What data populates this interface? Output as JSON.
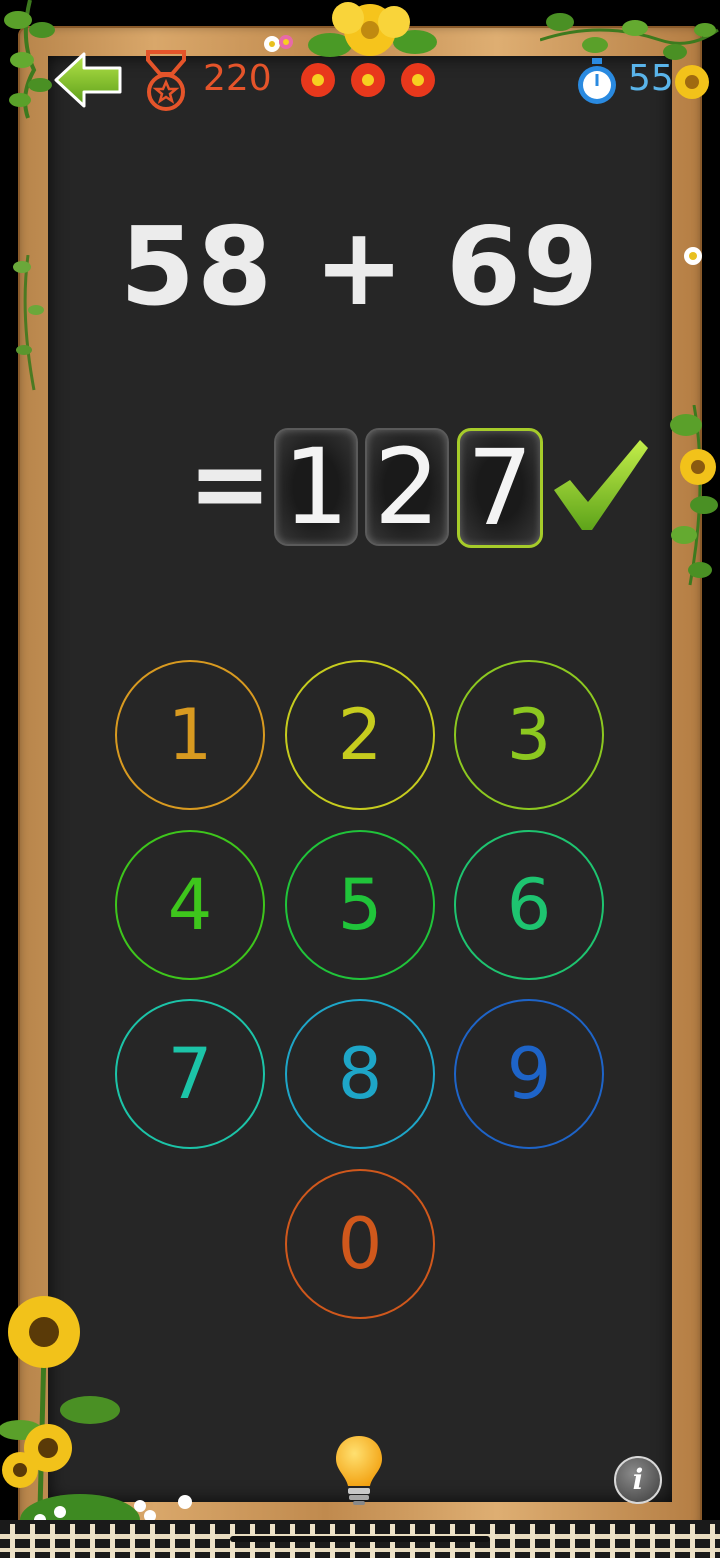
{
  "header": {
    "back_icon": "arrow-left-icon",
    "medal_icon": "medal-icon",
    "score": "220",
    "timer_icon": "stopwatch-icon",
    "timer": "55"
  },
  "problem": {
    "equation": "58 + 69",
    "equals": "=",
    "answer_digits": [
      "1",
      "2",
      "7"
    ],
    "active_index": 2,
    "status_icon": "checkmark-icon"
  },
  "keypad": [
    {
      "label": "1",
      "color": "#d89a20"
    },
    {
      "label": "2",
      "color": "#c6cc1e"
    },
    {
      "label": "3",
      "color": "#8cc820"
    },
    {
      "label": "4",
      "color": "#3ec61c"
    },
    {
      "label": "5",
      "color": "#20c43a"
    },
    {
      "label": "6",
      "color": "#1ec470"
    },
    {
      "label": "7",
      "color": "#1cc4a8"
    },
    {
      "label": "8",
      "color": "#1ea6c8"
    },
    {
      "label": "9",
      "color": "#1e64c8"
    },
    {
      "label": "0",
      "color": "#d0581c"
    }
  ],
  "footer": {
    "hint_icon": "lightbulb-icon",
    "info_label": "i"
  },
  "colors": {
    "board": "#262626",
    "frame": "#c99656",
    "accent_green": "#7cc41e",
    "score": "#e5542a",
    "timer": "#5ab4ea"
  }
}
